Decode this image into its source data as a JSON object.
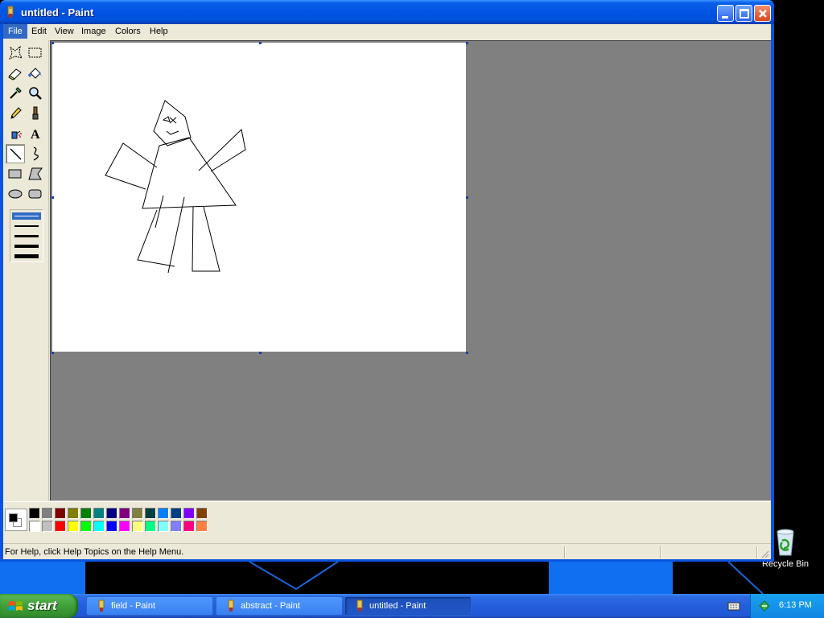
{
  "window": {
    "title": "untitled - Paint",
    "controls": [
      "minimize",
      "maximize",
      "close"
    ]
  },
  "menu": {
    "items": [
      {
        "label": "File",
        "active": true
      },
      {
        "label": "Edit",
        "active": false
      },
      {
        "label": "View",
        "active": false
      },
      {
        "label": "Image",
        "active": false
      },
      {
        "label": "Colors",
        "active": false
      },
      {
        "label": "Help",
        "active": false
      }
    ]
  },
  "toolbox": {
    "tools": [
      {
        "name": "free-form-select-icon"
      },
      {
        "name": "rect-select-icon"
      },
      {
        "name": "eraser-icon"
      },
      {
        "name": "fill-bucket-icon"
      },
      {
        "name": "eyedropper-icon"
      },
      {
        "name": "magnifier-icon"
      },
      {
        "name": "pencil-icon"
      },
      {
        "name": "brush-icon"
      },
      {
        "name": "airbrush-icon"
      },
      {
        "name": "text-icon"
      },
      {
        "name": "line-icon",
        "selected": true
      },
      {
        "name": "curve-icon"
      },
      {
        "name": "rectangle-icon"
      },
      {
        "name": "polygon-icon"
      },
      {
        "name": "ellipse-icon"
      },
      {
        "name": "rounded-rect-icon"
      }
    ],
    "text_tool_glyph": "A",
    "line_widths_selected_index": 0
  },
  "colors": {
    "foreground": "#000000",
    "background": "#ffffff",
    "palette_top": [
      "#000000",
      "#808080",
      "#800000",
      "#808000",
      "#008000",
      "#008080",
      "#000080",
      "#800080",
      "#808040",
      "#004040",
      "#0080ff",
      "#004080",
      "#8000ff",
      "#804000"
    ],
    "palette_bottom": [
      "#ffffff",
      "#c0c0c0",
      "#ff0000",
      "#ffff00",
      "#00ff00",
      "#00ffff",
      "#0000ff",
      "#ff00ff",
      "#ffff80",
      "#00ff80",
      "#80ffff",
      "#8080ff",
      "#ff0080",
      "#ff8040"
    ],
    "title_bar": "#0054e3",
    "menu_highlight": "#316ac5"
  },
  "status": {
    "text": "For Help, click Help Topics on the Help Menu."
  },
  "taskbar": {
    "start_label": "start",
    "tasks": [
      {
        "label": "field - Paint",
        "active": false
      },
      {
        "label": "abstract - Paint",
        "active": false
      },
      {
        "label": "untitled - Paint",
        "active": true
      }
    ],
    "clock": "6:13 PM"
  },
  "desktop": {
    "icons": [
      {
        "label": "Recycle Bin",
        "icon": "recycle-bin-icon"
      }
    ]
  }
}
